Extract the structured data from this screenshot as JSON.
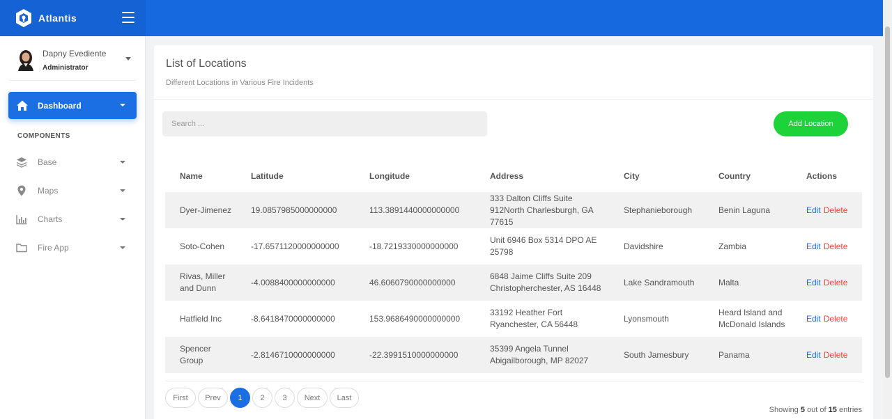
{
  "app": {
    "name": "Atlantis"
  },
  "user": {
    "name": "Dapny Evediente",
    "role": "Administrator"
  },
  "nav": {
    "active": "Dashboard",
    "section": "COMPONENTS",
    "items": [
      {
        "label": "Base",
        "icon": "layers-icon"
      },
      {
        "label": "Maps",
        "icon": "map-pin-icon"
      },
      {
        "label": "Charts",
        "icon": "bar-chart-icon"
      },
      {
        "label": "Fire App",
        "icon": "folder-icon"
      }
    ]
  },
  "card": {
    "title": "List of Locations",
    "subtitle": "Different Locations in Various Fire Incidents",
    "search_placeholder": "Search ...",
    "add_button": "Add Location"
  },
  "table": {
    "headers": [
      "Name",
      "Latitude",
      "Longitude",
      "Address",
      "City",
      "Country",
      "Actions"
    ],
    "rows": [
      {
        "name": "Dyer-Jimenez",
        "lat": "19.0857985000000000",
        "lon": "113.3891440000000000",
        "address": "333 Dalton Cliffs Suite 912North Charlesburgh, GA 77615",
        "city": "Stephanieborough",
        "country": "Benin Laguna"
      },
      {
        "name": "Soto-Cohen",
        "lat": "-17.6571120000000000",
        "lon": "-18.7219330000000000",
        "address": "Unit 6946 Box 5314 DPO AE 25798",
        "city": "Davidshire",
        "country": "Zambia"
      },
      {
        "name": "Rivas, Miller and Dunn",
        "lat": "-4.0088400000000000",
        "lon": "46.6060790000000000",
        "address": "6848 Jaime Cliffs Suite 209 Christopherchester, AS 16448",
        "city": "Lake Sandramouth",
        "country": "Malta"
      },
      {
        "name": "Hatfield Inc",
        "lat": "-8.6418470000000000",
        "lon": "153.9686490000000000",
        "address": "33192 Heather Fort Ryanchester, CA 56448",
        "city": "Lyonsmouth",
        "country": "Heard Island and McDonald Islands"
      },
      {
        "name": "Spencer Group",
        "lat": "-2.8146710000000000",
        "lon": "-22.3991510000000000",
        "address": "35399 Angela Tunnel Abigailborough, MP 82027",
        "city": "South Jamesbury",
        "country": "Panama"
      }
    ],
    "edit_label": "Edit",
    "delete_label": "Delete"
  },
  "pagination": {
    "first": "First",
    "prev": "Prev",
    "pages": [
      "1",
      "2",
      "3"
    ],
    "current": "1",
    "next": "Next",
    "last": "Last",
    "showing_prefix": "Showing",
    "showing_count": "5",
    "showing_mid": "out of",
    "showing_total": "15",
    "showing_suffix": "entries"
  },
  "colors": {
    "topbar": "#1769e0",
    "accent": "#1b6fe3",
    "add_button": "#1ed33a",
    "delete": "#e8433d"
  }
}
